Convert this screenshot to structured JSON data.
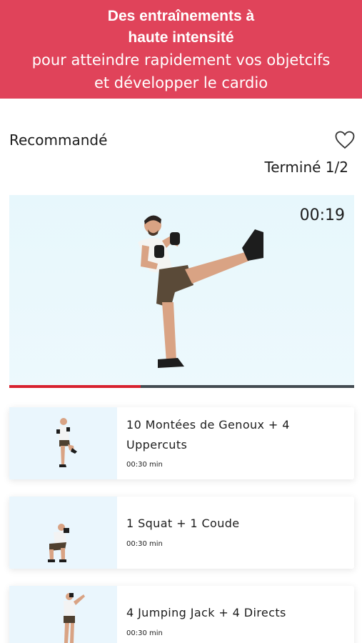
{
  "banner": {
    "line1": "Des entraînements à",
    "line2": "haute intensité",
    "line3": "pour atteindre rapidement vos objetcifs",
    "line4": "et développer le cardio"
  },
  "section": {
    "title": "Recommandé",
    "favorite_icon": "heart-outline-icon",
    "progress_text": "Terminé 1/2"
  },
  "player": {
    "timer": "00:19",
    "progress_fraction": 0.38,
    "progress_color": "#d8222f"
  },
  "exercises": [
    {
      "name": "10 Montées de Genoux + 4 Uppercuts",
      "duration": "00:30 min"
    },
    {
      "name": "1 Squat + 1 Coude",
      "duration": "00:30 min"
    },
    {
      "name": "4 Jumping Jack + 4 Directs",
      "duration": "00:30 min"
    }
  ],
  "colors": {
    "brand": "#e0435a",
    "accent": "#d8222f",
    "track": "#444c52"
  }
}
